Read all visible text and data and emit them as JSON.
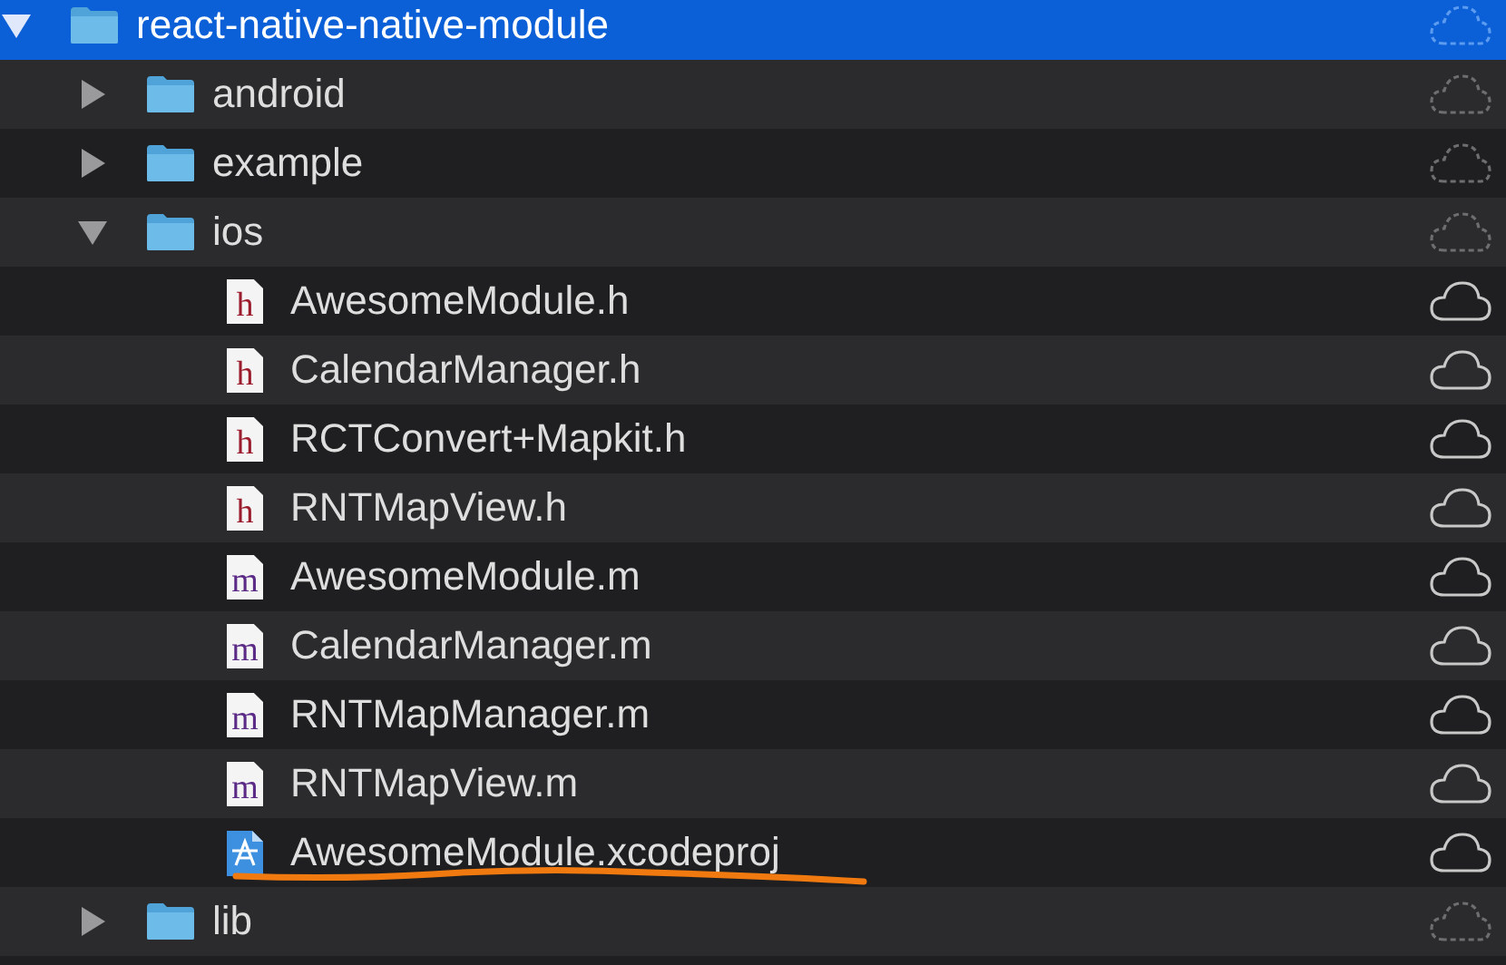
{
  "tree": [
    {
      "kind": "folder",
      "name": "react-native-native-module",
      "expanded": true,
      "selected": true,
      "downloaded": false,
      "children": [
        {
          "kind": "folder",
          "name": "android",
          "expanded": false,
          "selected": false,
          "downloaded": false
        },
        {
          "kind": "folder",
          "name": "example",
          "expanded": false,
          "selected": false,
          "downloaded": false
        },
        {
          "kind": "folder",
          "name": "ios",
          "expanded": true,
          "selected": false,
          "downloaded": false,
          "children": [
            {
              "kind": "source",
              "icon_text": "h",
              "name": "AwesomeModule.h",
              "selected": false,
              "downloaded": true
            },
            {
              "kind": "source",
              "icon_text": "h",
              "name": "CalendarManager.h",
              "selected": false,
              "downloaded": true
            },
            {
              "kind": "source",
              "icon_text": "h",
              "name": "RCTConvert+Mapkit.h",
              "selected": false,
              "downloaded": true
            },
            {
              "kind": "source",
              "icon_text": "h",
              "name": "RNTMapView.h",
              "selected": false,
              "downloaded": true
            },
            {
              "kind": "source",
              "icon_text": "m",
              "name": "AwesomeModule.m",
              "selected": false,
              "downloaded": true
            },
            {
              "kind": "source",
              "icon_text": "m",
              "name": "CalendarManager.m",
              "selected": false,
              "downloaded": true
            },
            {
              "kind": "source",
              "icon_text": "m",
              "name": "RNTMapManager.m",
              "selected": false,
              "downloaded": true
            },
            {
              "kind": "source",
              "icon_text": "m",
              "name": "RNTMapView.m",
              "selected": false,
              "downloaded": true
            },
            {
              "kind": "project",
              "name": "AwesomeModule.xcodeproj",
              "selected": false,
              "downloaded": true,
              "underlined": true
            }
          ]
        },
        {
          "kind": "folder",
          "name": "lib",
          "expanded": false,
          "selected": false,
          "downloaded": false
        }
      ]
    }
  ]
}
